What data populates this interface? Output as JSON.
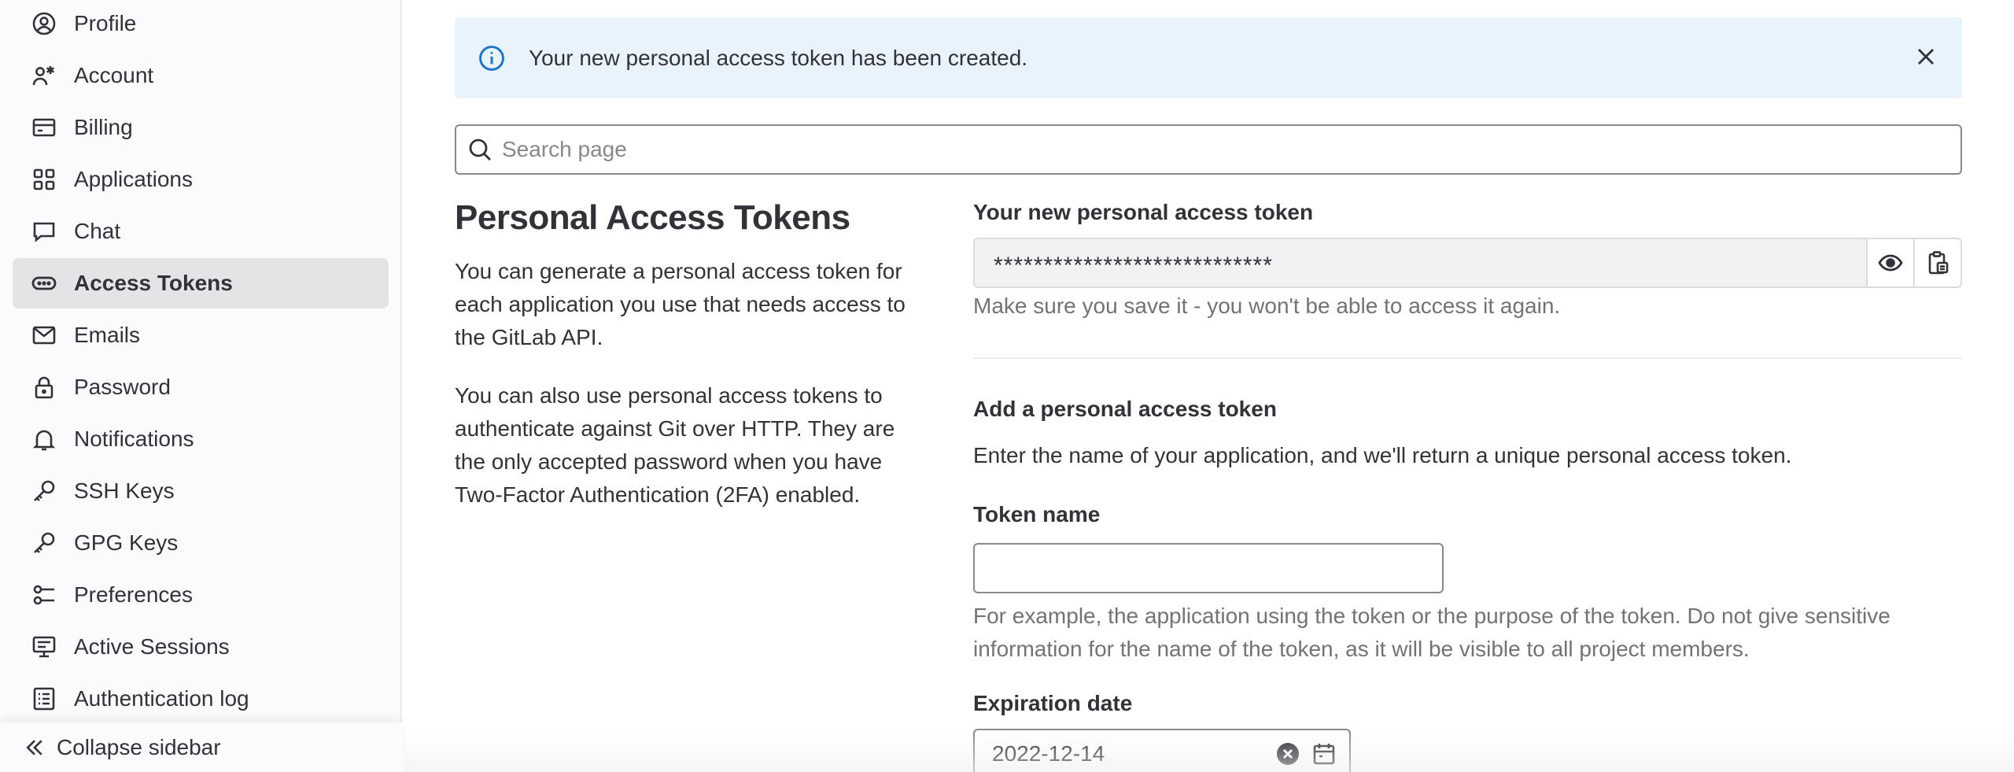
{
  "sidebar": {
    "items": [
      {
        "label": "Profile",
        "icon": "profile-icon"
      },
      {
        "label": "Account",
        "icon": "account-icon"
      },
      {
        "label": "Billing",
        "icon": "billing-icon"
      },
      {
        "label": "Applications",
        "icon": "applications-icon"
      },
      {
        "label": "Chat",
        "icon": "chat-icon"
      },
      {
        "label": "Access Tokens",
        "icon": "token-icon",
        "active": true
      },
      {
        "label": "Emails",
        "icon": "mail-icon"
      },
      {
        "label": "Password",
        "icon": "lock-icon"
      },
      {
        "label": "Notifications",
        "icon": "bell-icon"
      },
      {
        "label": "SSH Keys",
        "icon": "key-icon"
      },
      {
        "label": "GPG Keys",
        "icon": "key-icon"
      },
      {
        "label": "Preferences",
        "icon": "preferences-icon"
      },
      {
        "label": "Active Sessions",
        "icon": "monitor-icon"
      },
      {
        "label": "Authentication log",
        "icon": "log-icon"
      }
    ],
    "collapse_label": "Collapse sidebar"
  },
  "alert": {
    "message": "Your new personal access token has been created."
  },
  "search": {
    "placeholder": "Search page"
  },
  "main": {
    "title": "Personal Access Tokens",
    "description_1": "You can generate a personal access token for each application you use that needs access to the GitLab API.",
    "description_2": "You can also use personal access tokens to authenticate against Git over HTTP. They are the only accepted password when you have Two-Factor Authentication (2FA) enabled."
  },
  "new_token": {
    "label": "Your new personal access token",
    "value": "****************************",
    "help": "Make sure you save it - you won't be able to access it again."
  },
  "add_token": {
    "heading": "Add a personal access token",
    "intro": "Enter the name of your application, and we'll return a unique personal access token.",
    "name_label": "Token name",
    "name_value": "",
    "name_help": "For example, the application using the token or the purpose of the token. Do not give sensitive information for the name of the token, as it will be visible to all project members.",
    "expiration_label": "Expiration date",
    "expiration_value": "2022-12-14"
  },
  "colors": {
    "alert_bg": "#e9f3fc",
    "info_blue": "#1f75cb",
    "active_item_bg": "#e4e4e6",
    "text": "#333238",
    "muted": "#737278"
  }
}
